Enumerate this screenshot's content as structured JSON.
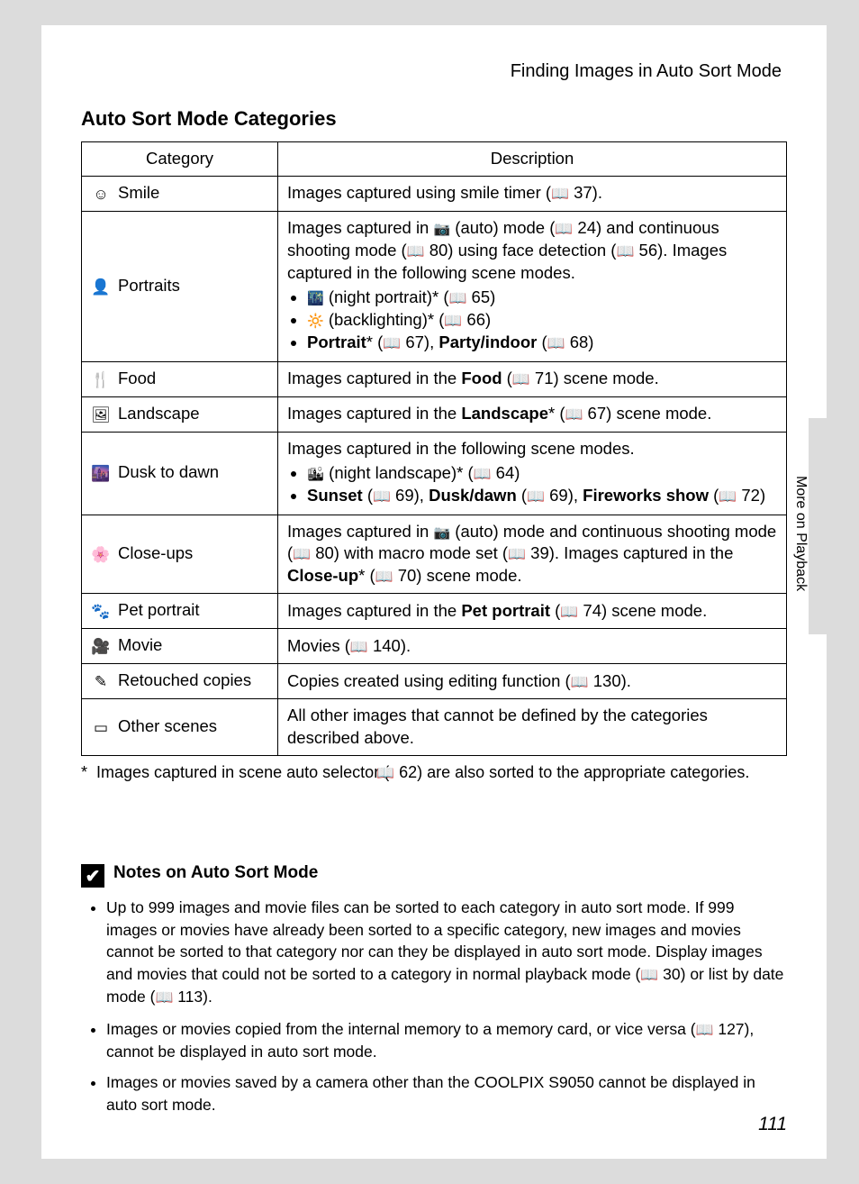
{
  "header": {
    "breadcrumb": "Finding Images in Auto Sort Mode"
  },
  "section_title": "Auto Sort Mode Categories",
  "side_tab": "More on Playback",
  "page_number": "111",
  "table": {
    "headers": {
      "category": "Category",
      "description": "Description"
    },
    "rows": [
      {
        "icon": "smile-icon",
        "glyph": "☺",
        "name": "Smile",
        "desc_html": "Images captured using smile timer (<span class='book'>📖</span> 37)."
      },
      {
        "icon": "portrait-icon",
        "glyph": "👤",
        "name": "Portraits",
        "desc_html": "Images captured in <span class='inline-ic'>📷</span> (auto) mode (<span class='book'>📖</span> 24) and continuous shooting mode (<span class='book'>📖</span> 80) using face detection (<span class='book'>📖</span> 56). Images captured in the following scene modes.<ul><li><span class='inline-ic'>🌃</span> (night portrait)* (<span class='book'>📖</span> 65)</li><li><span class='inline-ic'>🔆</span> (backlighting)* (<span class='book'>📖</span> 66)</li><li><span class='bold'>Portrait</span>* (<span class='book'>📖</span> 67), <span class='bold'>Party/indoor</span> (<span class='book'>📖</span> 68)</li></ul>"
      },
      {
        "icon": "food-icon",
        "glyph": "🍴",
        "name": "Food",
        "desc_html": "Images captured in the <span class='bold'>Food</span> (<span class='book'>📖</span> 71) scene mode."
      },
      {
        "icon": "landscape-icon",
        "glyph": "🖼",
        "name": "Landscape",
        "desc_html": "Images captured in the <span class='bold'>Landscape</span>* (<span class='book'>📖</span> 67) scene mode."
      },
      {
        "icon": "dusk-icon",
        "glyph": "🌆",
        "name": "Dusk to dawn",
        "desc_html": "Images captured in the following scene modes.<ul><li><span class='inline-ic'>🏙</span> (night landscape)* (<span class='book'>📖</span> 64)</li><li><span class='bold'>Sunset</span> (<span class='book'>📖</span> 69), <span class='bold'>Dusk/dawn</span> (<span class='book'>📖</span> 69), <span class='bold'>Fireworks show</span> (<span class='book'>📖</span> 72)</li></ul>"
      },
      {
        "icon": "closeup-icon",
        "glyph": "🌸",
        "name": "Close-ups",
        "desc_html": "Images captured in <span class='inline-ic'>📷</span> (auto) mode and continuous shooting mode (<span class='book'>📖</span> 80) with macro mode set (<span class='book'>📖</span> 39). Images captured in the <span class='bold'>Close-up</span>* (<span class='book'>📖</span> 70) scene mode."
      },
      {
        "icon": "pet-icon",
        "glyph": "🐾",
        "name": "Pet portrait",
        "desc_html": "Images captured in the <span class='bold'>Pet portrait</span> (<span class='book'>📖</span> 74) scene mode."
      },
      {
        "icon": "movie-icon",
        "glyph": "🎥",
        "name": "Movie",
        "desc_html": "Movies (<span class='book'>📖</span> 140)."
      },
      {
        "icon": "retouch-icon",
        "glyph": "✎",
        "name": "Retouched copies",
        "desc_html": "Copies created using editing function (<span class='book'>📖</span> 130)."
      },
      {
        "icon": "other-icon",
        "glyph": "▭",
        "name": "Other scenes",
        "desc_html": "All other images that cannot be defined by the categories described above."
      }
    ]
  },
  "footnote_html": "*&nbsp;&nbsp;Images captured in scene auto selector (<span class='book'>📖</span> 62) are also sorted to the appropriate categories.",
  "notes": {
    "title": "Notes on Auto Sort Mode",
    "items": [
      "Up to 999 images and movie files can be sorted to each category in auto sort mode. If 999 images or movies have already been sorted to a specific category, new images and movies cannot be sorted to that category nor can they be displayed in auto sort mode. Display images and movies that could not be sorted to a category in normal playback mode (<span class='book'>📖</span> 30) or list by date mode (<span class='book'>📖</span> 113).",
      "Images or movies copied from the internal memory to a memory card, or vice versa (<span class='book'>📖</span> 127), cannot be displayed in auto sort mode.",
      "Images or movies saved by a camera other than the COOLPIX S9050 cannot be displayed in auto sort mode."
    ]
  }
}
